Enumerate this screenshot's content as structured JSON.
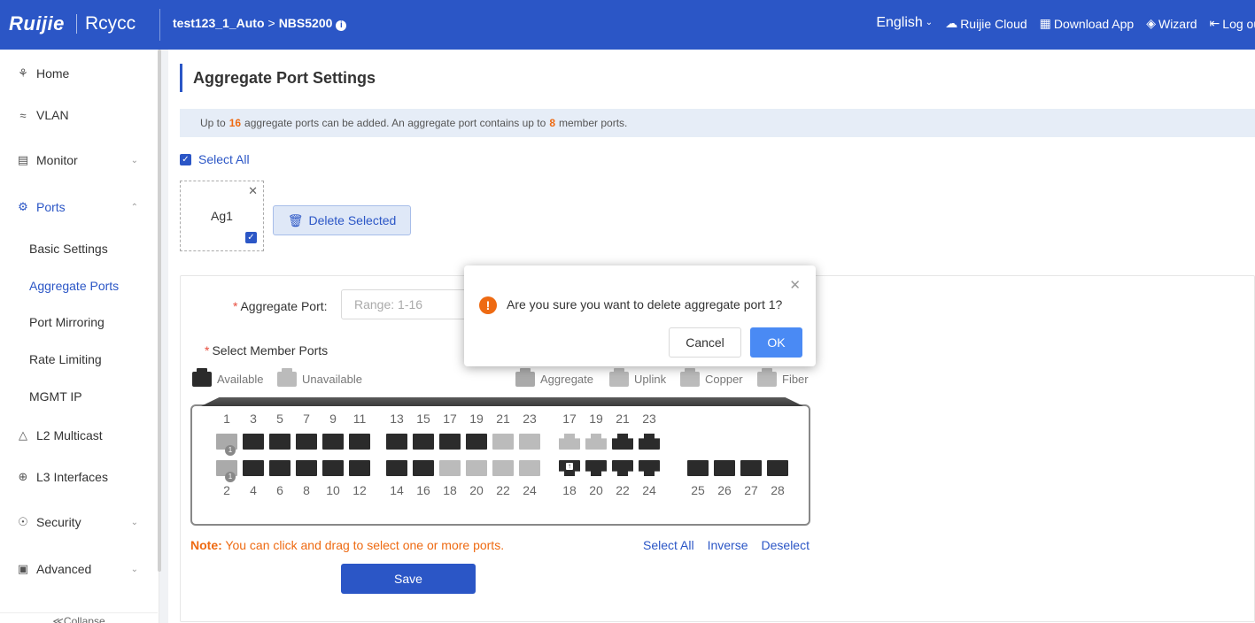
{
  "header": {
    "logo": "Ruijie",
    "brand2": "Rcycc",
    "breadcrumb": [
      "test123_1_Auto",
      "NBS5200"
    ],
    "language": "English",
    "cloud_label": "Ruijie Cloud",
    "download_label": "Download App",
    "wizard_label": "Wizard",
    "logout_label": "Log out"
  },
  "sidebar": {
    "items": [
      {
        "label": "Home",
        "icon": "home-icon"
      },
      {
        "label": "VLAN",
        "icon": "vlan-icon"
      },
      {
        "label": "Monitor",
        "icon": "monitor-icon"
      },
      {
        "label": "Ports",
        "icon": "ports-icon"
      },
      {
        "label": "L2 Multicast",
        "icon": "multicast-icon"
      },
      {
        "label": "L3 Interfaces",
        "icon": "globe-icon"
      },
      {
        "label": "Security",
        "icon": "shield-icon"
      },
      {
        "label": "Advanced",
        "icon": "toolbox-icon"
      }
    ],
    "sub_items": [
      "Basic Settings",
      "Aggregate Ports",
      "Port Mirroring",
      "Rate Limiting",
      "MGMT IP"
    ],
    "collapse_label": "Collapse"
  },
  "main": {
    "title": "Aggregate Port Settings",
    "tip": {
      "part1": "Up to",
      "max_ports": "16",
      "part2": "aggregate ports can be added. An aggregate port contains up to",
      "max_members": "8",
      "part3": "member ports."
    },
    "select_all": "Select All",
    "aggregate_card": "Ag1",
    "delete_selected": "Delete Selected",
    "form": {
      "aggregate_port_label": "Aggregate Port:",
      "aggregate_port_placeholder": "Range: 1-16",
      "member_ports_label": "Select Member Ports",
      "legend": {
        "available": "Available",
        "unavailable": "Unavailable",
        "aggregate": "Aggregate",
        "uplink": "Uplink",
        "copper": "Copper",
        "fiber": "Fiber"
      },
      "ports": {
        "top_left": [
          "1",
          "3",
          "5",
          "7",
          "9",
          "11"
        ],
        "top_mid": [
          "13",
          "15",
          "17",
          "19",
          "21",
          "23"
        ],
        "top_right": [
          "17",
          "19",
          "21",
          "23"
        ],
        "bot_left": [
          "2",
          "4",
          "6",
          "8",
          "10",
          "12"
        ],
        "bot_mid": [
          "14",
          "16",
          "18",
          "20",
          "22",
          "24"
        ],
        "bot_right": [
          "18",
          "20",
          "22",
          "24"
        ],
        "sfp": [
          "25",
          "26",
          "27",
          "28"
        ]
      },
      "aggregate_member_badge": "1",
      "note_label": "Note:",
      "note_text": "You can click and drag to select one or more ports.",
      "link_select_all": "Select All",
      "link_inverse": "Inverse",
      "link_deselect": "Deselect",
      "save": "Save"
    }
  },
  "dialog": {
    "message": "Are you sure you want to delete aggregate port 1?",
    "cancel": "Cancel",
    "ok": "OK"
  },
  "colors": {
    "primary": "#2b56c6",
    "warning": "#ee6a12",
    "ok_button": "#4a8af4"
  }
}
